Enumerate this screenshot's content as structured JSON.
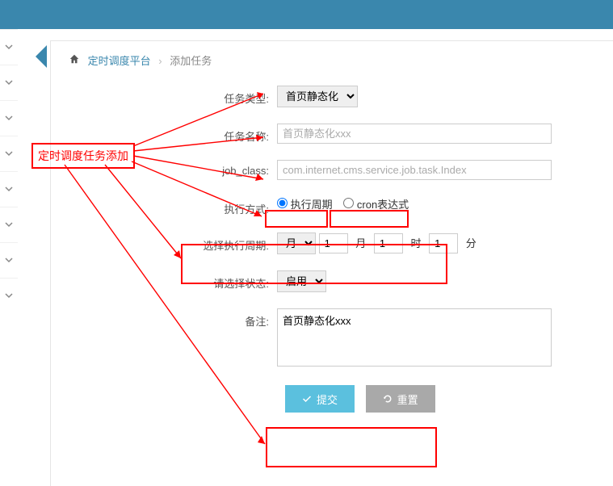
{
  "breadcrumb": {
    "link": "定时调度平台",
    "current": "添加任务"
  },
  "annotations": {
    "callout": "定时调度任务添加"
  },
  "form": {
    "task_type": {
      "label": "任务类型:",
      "options": [
        "首页静态化"
      ],
      "selected": "首页静态化"
    },
    "task_name": {
      "label": "任务名称:",
      "placeholder": "首页静态化xxx",
      "value": ""
    },
    "job_class": {
      "label": "job_class:",
      "placeholder": "com.internet.cms.service.job.task.Index",
      "value": ""
    },
    "exec_mode": {
      "label": "执行方式:",
      "options": [
        {
          "value": "period",
          "label": "执行周期",
          "checked": true
        },
        {
          "value": "cron",
          "label": "cron表达式",
          "checked": false
        }
      ]
    },
    "period": {
      "label": "选择执行周期:",
      "interval_unit_options": [
        "月"
      ],
      "interval_unit_selected": "月",
      "month": "1",
      "month_label": "月",
      "hour": "1",
      "hour_label": "时",
      "minute": "1",
      "minute_label": "分"
    },
    "status": {
      "label": "请选择状态:",
      "options": [
        "启用"
      ],
      "selected": "启用"
    },
    "remark": {
      "label": "备注:",
      "value": "首页静态化xxx"
    },
    "buttons": {
      "submit": "提交",
      "reset": "重置"
    }
  }
}
